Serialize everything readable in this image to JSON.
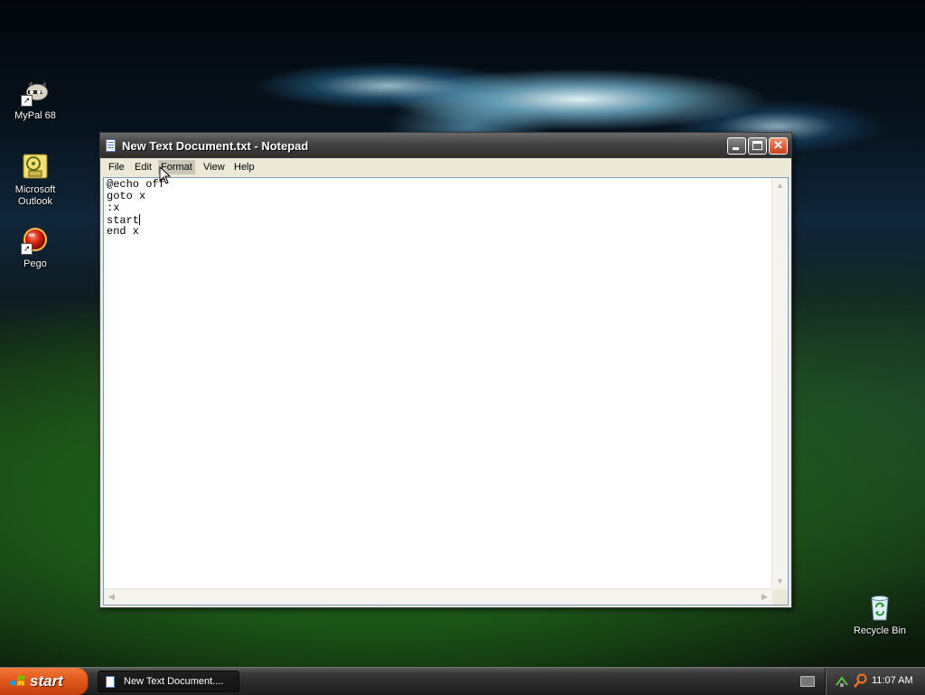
{
  "desktop": {
    "icons": [
      {
        "label": "MyPal 68",
        "icon": "raccoon-icon",
        "shortcut": true
      },
      {
        "label": "Microsoft Outlook",
        "icon": "outlook-icon",
        "shortcut": false
      },
      {
        "label": "Pego",
        "icon": "pego-red-ball-icon",
        "shortcut": true
      },
      {
        "label": "Recycle Bin",
        "icon": "recycle-bin-icon",
        "shortcut": false
      }
    ]
  },
  "window": {
    "title": "New Text Document.txt - Notepad",
    "menu": [
      "File",
      "Edit",
      "Format",
      "View",
      "Help"
    ],
    "active_menu": "Format",
    "editor_lines": [
      "@echo off",
      "goto x",
      ":x",
      "start",
      "end x"
    ]
  },
  "taskbar": {
    "start_label": "start",
    "task_button_label": "New Text Document....",
    "clock": "11:07 AM"
  },
  "colors": {
    "start_button": "#e0581c",
    "close_button": "#c8401e",
    "titlebar": "#3b3b3b",
    "editor_border": "#7f9db9"
  }
}
